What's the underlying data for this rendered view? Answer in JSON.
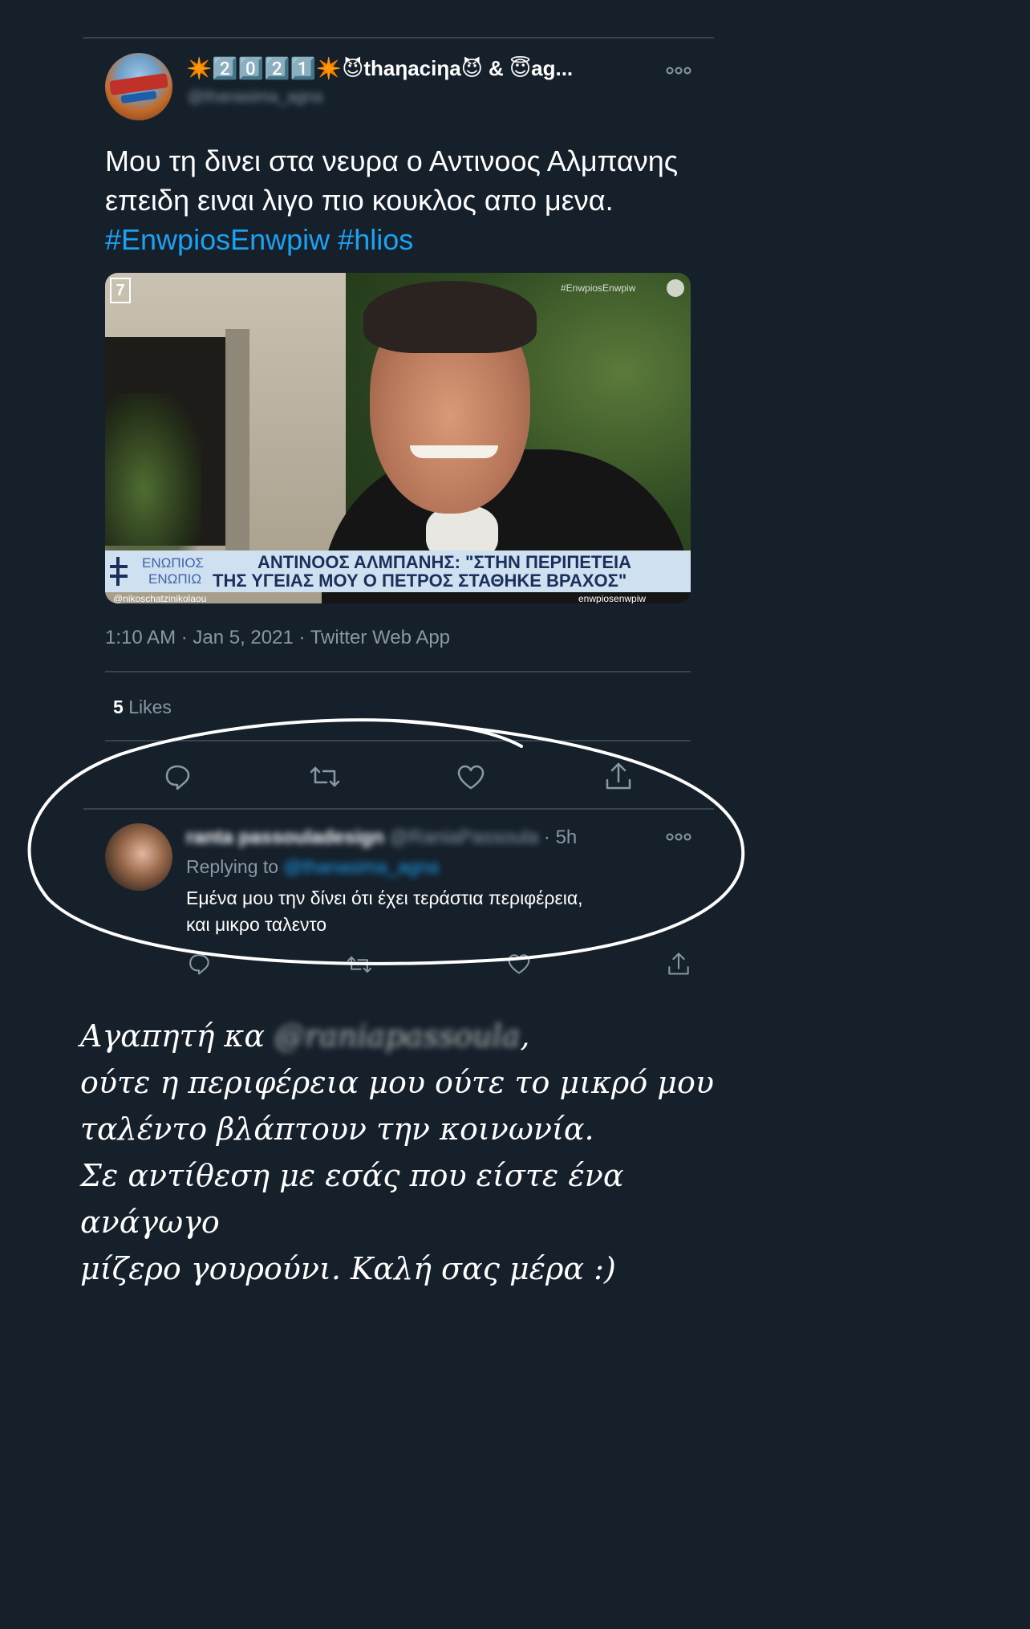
{
  "tweet": {
    "display_name": "✴️2️⃣0️⃣2️⃣1️⃣✴️😈thaηaciηa😈 & 😇ag...",
    "handle": "@thanasima_agna",
    "text": "Μου τη δινει στα νευρα ο Αντινοος Αλμπανης επειδη ειναι λιγο πιο κουκλος απο μενα.",
    "hashtag1": "#EnwpiosEnwpiw",
    "hashtag2": "#hlios",
    "timestamp": "1:10 AM · Jan 5, 2021 · Twitter Web App",
    "likes_count": "5",
    "likes_label": "Likes",
    "media": {
      "watermark": "#EnwpiosEnwpiw",
      "channel_logo": "7",
      "show_name_line1": "ΕΝΩΠΙΟΣ",
      "show_name_line2": "ΕΝΩΠΙΩ",
      "caption_line1": "ΑΝΤΙΝΟΟΣ ΑΛΜΠΑΝΗΣ: \"ΣΤΗΝ ΠΕΡΙΠΕΤΕΙΑ",
      "caption_line2": "ΤΗΣ ΥΓΕΙΑΣ ΜΟΥ Ο ΠΕΤΡΟΣ ΣΤΑΘΗΚΕ ΒΡΑΧΟΣ\"",
      "bottom_left_handle": "@nikoschatzinikolaou",
      "bottom_right_handle": "enwpiosenwpiw"
    }
  },
  "reply": {
    "name": "ranta passouladesign",
    "handle": "@RaniaPassoula",
    "time": "· 5h",
    "replying_label": "Replying to",
    "replying_handle": "@thanasima_agna",
    "text_line1": "Εμένα μου την δίνει ότι έχει τεράστια περιφέρεια,",
    "text_line2": "και μικρο ταλεντο"
  },
  "story_text": {
    "line1_prefix": "Αγαπητή κα",
    "line1_handle": "@raniapassoula",
    "line1_suffix": ",",
    "line2": "ούτε η περιφέρεια μου ούτε το μικρό μου",
    "line3": "ταλέντο βλάπτουν την κοινωνία.",
    "line4": "Σε αντίθεση με εσάς που είστε ένα ανάγωγο",
    "line5": "μίζερο γουρούνι. Καλή σας μέρα :)"
  },
  "colors": {
    "background": "#15202b",
    "divider": "#38444d",
    "muted": "#8899a6",
    "accent": "#1da1f2",
    "caption_band": "#cfe0f0",
    "caption_text": "#1a2f5a"
  }
}
